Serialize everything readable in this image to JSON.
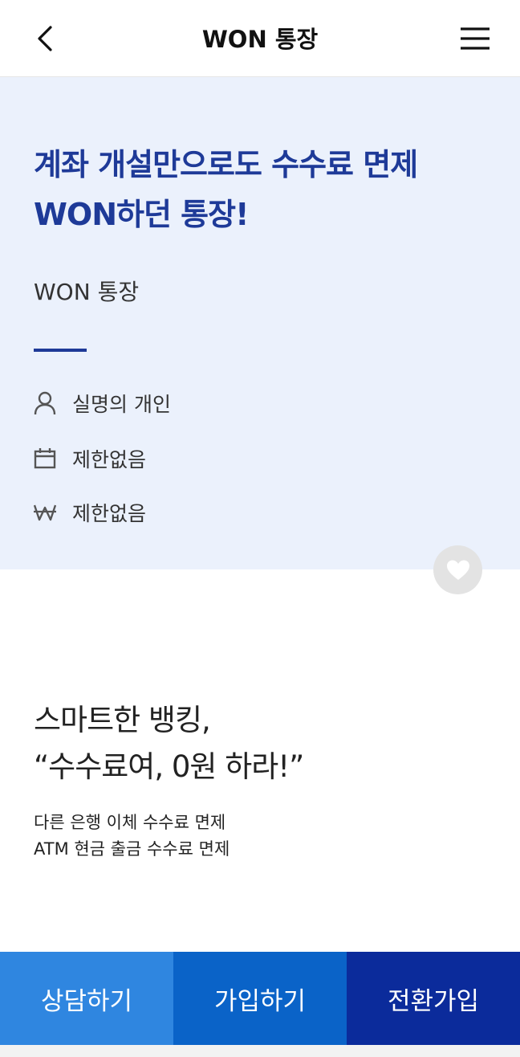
{
  "header": {
    "title": "WON 통장",
    "back_icon": "chevron-left-icon",
    "menu_icon": "hamburger-menu-icon"
  },
  "hero": {
    "headline_line1": "계좌 개설만으로도 수수료 면제",
    "headline_line2": "WON하던 통장!",
    "product_name": "WON 통장",
    "info": [
      {
        "icon": "person-icon",
        "text": "실명의 개인"
      },
      {
        "icon": "calendar-icon",
        "text": "제한없음"
      },
      {
        "icon": "won-currency-icon",
        "text": "제한없음"
      }
    ],
    "accent_color": "#1e3a98",
    "background_color": "#ebf1fc"
  },
  "favorite": {
    "icon": "heart-icon"
  },
  "feature": {
    "title_line1": "스마트한 뱅킹,",
    "title_line2": "“수수료여, 0원 하라!”",
    "desc_line1": "다른 은행 이체 수수료 면제",
    "desc_line2": "ATM 현금 출금 수수료 면제"
  },
  "actions": {
    "consult_label": "상담하기",
    "join_label": "가입하기",
    "switch_label": "전환가입",
    "consult_color": "#2f86e0",
    "join_color": "#0a63c8",
    "switch_color": "#0b2b9b"
  }
}
